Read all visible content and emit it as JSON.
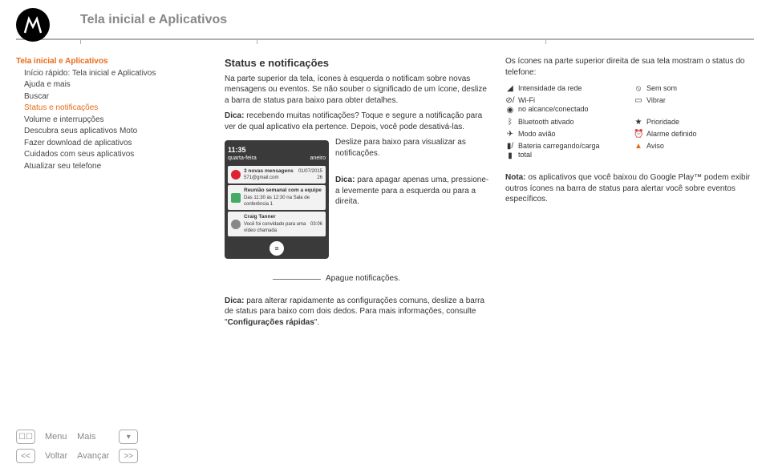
{
  "header": {
    "title": "Tela inicial e Aplicativos"
  },
  "sidebar": {
    "items": [
      {
        "label": "Tela inicial e Aplicativos",
        "active": true,
        "sub": false
      },
      {
        "label": "Início rápido: Tela inicial e Aplicativos",
        "active": false,
        "sub": true
      },
      {
        "label": "Ajuda e mais",
        "active": false,
        "sub": true
      },
      {
        "label": "Buscar",
        "active": false,
        "sub": true
      },
      {
        "label": "Status e notificações",
        "active": true,
        "sub": true
      },
      {
        "label": "Volume e interrupções",
        "active": false,
        "sub": true
      },
      {
        "label": "Descubra seus aplicativos Moto",
        "active": false,
        "sub": true
      },
      {
        "label": "Fazer download de aplicativos",
        "active": false,
        "sub": true
      },
      {
        "label": "Cuidados com seus aplicativos",
        "active": false,
        "sub": true
      },
      {
        "label": "Atualizar seu telefone",
        "active": false,
        "sub": true
      }
    ]
  },
  "middle": {
    "h2": "Status e notificações",
    "p1": "Na parte superior da tela, ícones à esquerda o notificam sobre novas mensagens ou eventos. Se não souber o significado de um ícone, deslize a barra de status para baixo para obter detalhes.",
    "p2_label": "Dica:",
    "p2": " recebendo muitas notificações? Toque e segure a notificação para ver de qual aplicativo ela pertence. Depois, você pode desativá-las.",
    "anno1": "Deslize para baixo para visualizar as notificações.",
    "anno2_label": "Dica:",
    "anno2": " para apagar apenas uma, pressione-a levemente para a esquerda ou para a direita.",
    "anno3": "Apague notificações.",
    "p3_label": "Dica:",
    "p3_a": " para alterar rapidamente as configurações comuns, deslize a barra de status para baixo com dois dedos. Para mais informações, consulte \"",
    "p3_b": "Configurações rápidas",
    "p3_c": "\"."
  },
  "phone": {
    "time": "11:35",
    "date": "quarta-feira",
    "date2": "aneiro",
    "mail_title": "3 novas mensagens",
    "mail_sub": "571@gmail.com",
    "mail_date": "01/07/2015",
    "mail_count": "26",
    "cal_title": "Reunião semanal com a equipe",
    "cal_sub": "Das 11:30 às 12:30 na Sala de conferência 1",
    "vid_title": "Craig Tanner",
    "vid_sub": "Você foi convidado para uma vídeo chamada",
    "vid_time": "03:06",
    "clear": "≡"
  },
  "right": {
    "intro": "Os ícones na parte superior direita de sua tela mostram o status do telefone:",
    "status": {
      "signal": "Intensidade da rede",
      "mute": "Sem som",
      "wifi_label": "Wi-Fi",
      "wifi_sub": "no alcance/conectado",
      "vibrate": "Vibrar",
      "bt": "Bluetooth ativado",
      "priority": "Prioridade",
      "airplane": "Modo avião",
      "alarm": "Alarme definido",
      "battery_label": "Bateria carregando/carga",
      "battery_sub": "total",
      "warning": "Aviso"
    },
    "note_label": "Nota:",
    "note": " os aplicativos que você baixou do Google Play™ podem exibir outros ícones na barra de status para alertar você sobre eventos específicos."
  },
  "footer": {
    "menu": "Menu",
    "mais": "Mais",
    "voltar": "Voltar",
    "avancar": "Avançar",
    "back": "<<",
    "fwd": ">>"
  }
}
